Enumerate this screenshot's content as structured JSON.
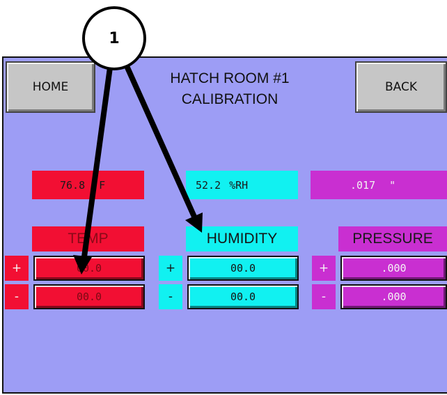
{
  "header": {
    "title_line1": "HATCH ROOM #1",
    "title_line2": "CALIBRATION",
    "home_label": "HOME",
    "back_label": "BACK"
  },
  "readings": {
    "temp": {
      "value": "76.8",
      "unit": "F"
    },
    "humidity": {
      "value": "52.2",
      "unit": "%RH"
    },
    "pressure": {
      "value": ".017",
      "unit": "\""
    }
  },
  "sections": {
    "temp": {
      "label": "TEMP",
      "plus_value": "00.0",
      "minus_value": "00.0"
    },
    "humidity": {
      "label": "HUMIDITY",
      "plus_value": "00.0",
      "minus_value": "00.0"
    },
    "pressure": {
      "label": "PRESSURE",
      "plus_value": ".000",
      "minus_value": ".000"
    }
  },
  "signs": {
    "plus": "+",
    "minus": "-"
  },
  "annotation": {
    "callout_number": "1"
  },
  "colors": {
    "panel_background": "#9d9df5",
    "temp": "#f20f33",
    "humidity": "#11f1f1",
    "pressure": "#c92fd1",
    "button_gray": "#c6c6c6"
  }
}
